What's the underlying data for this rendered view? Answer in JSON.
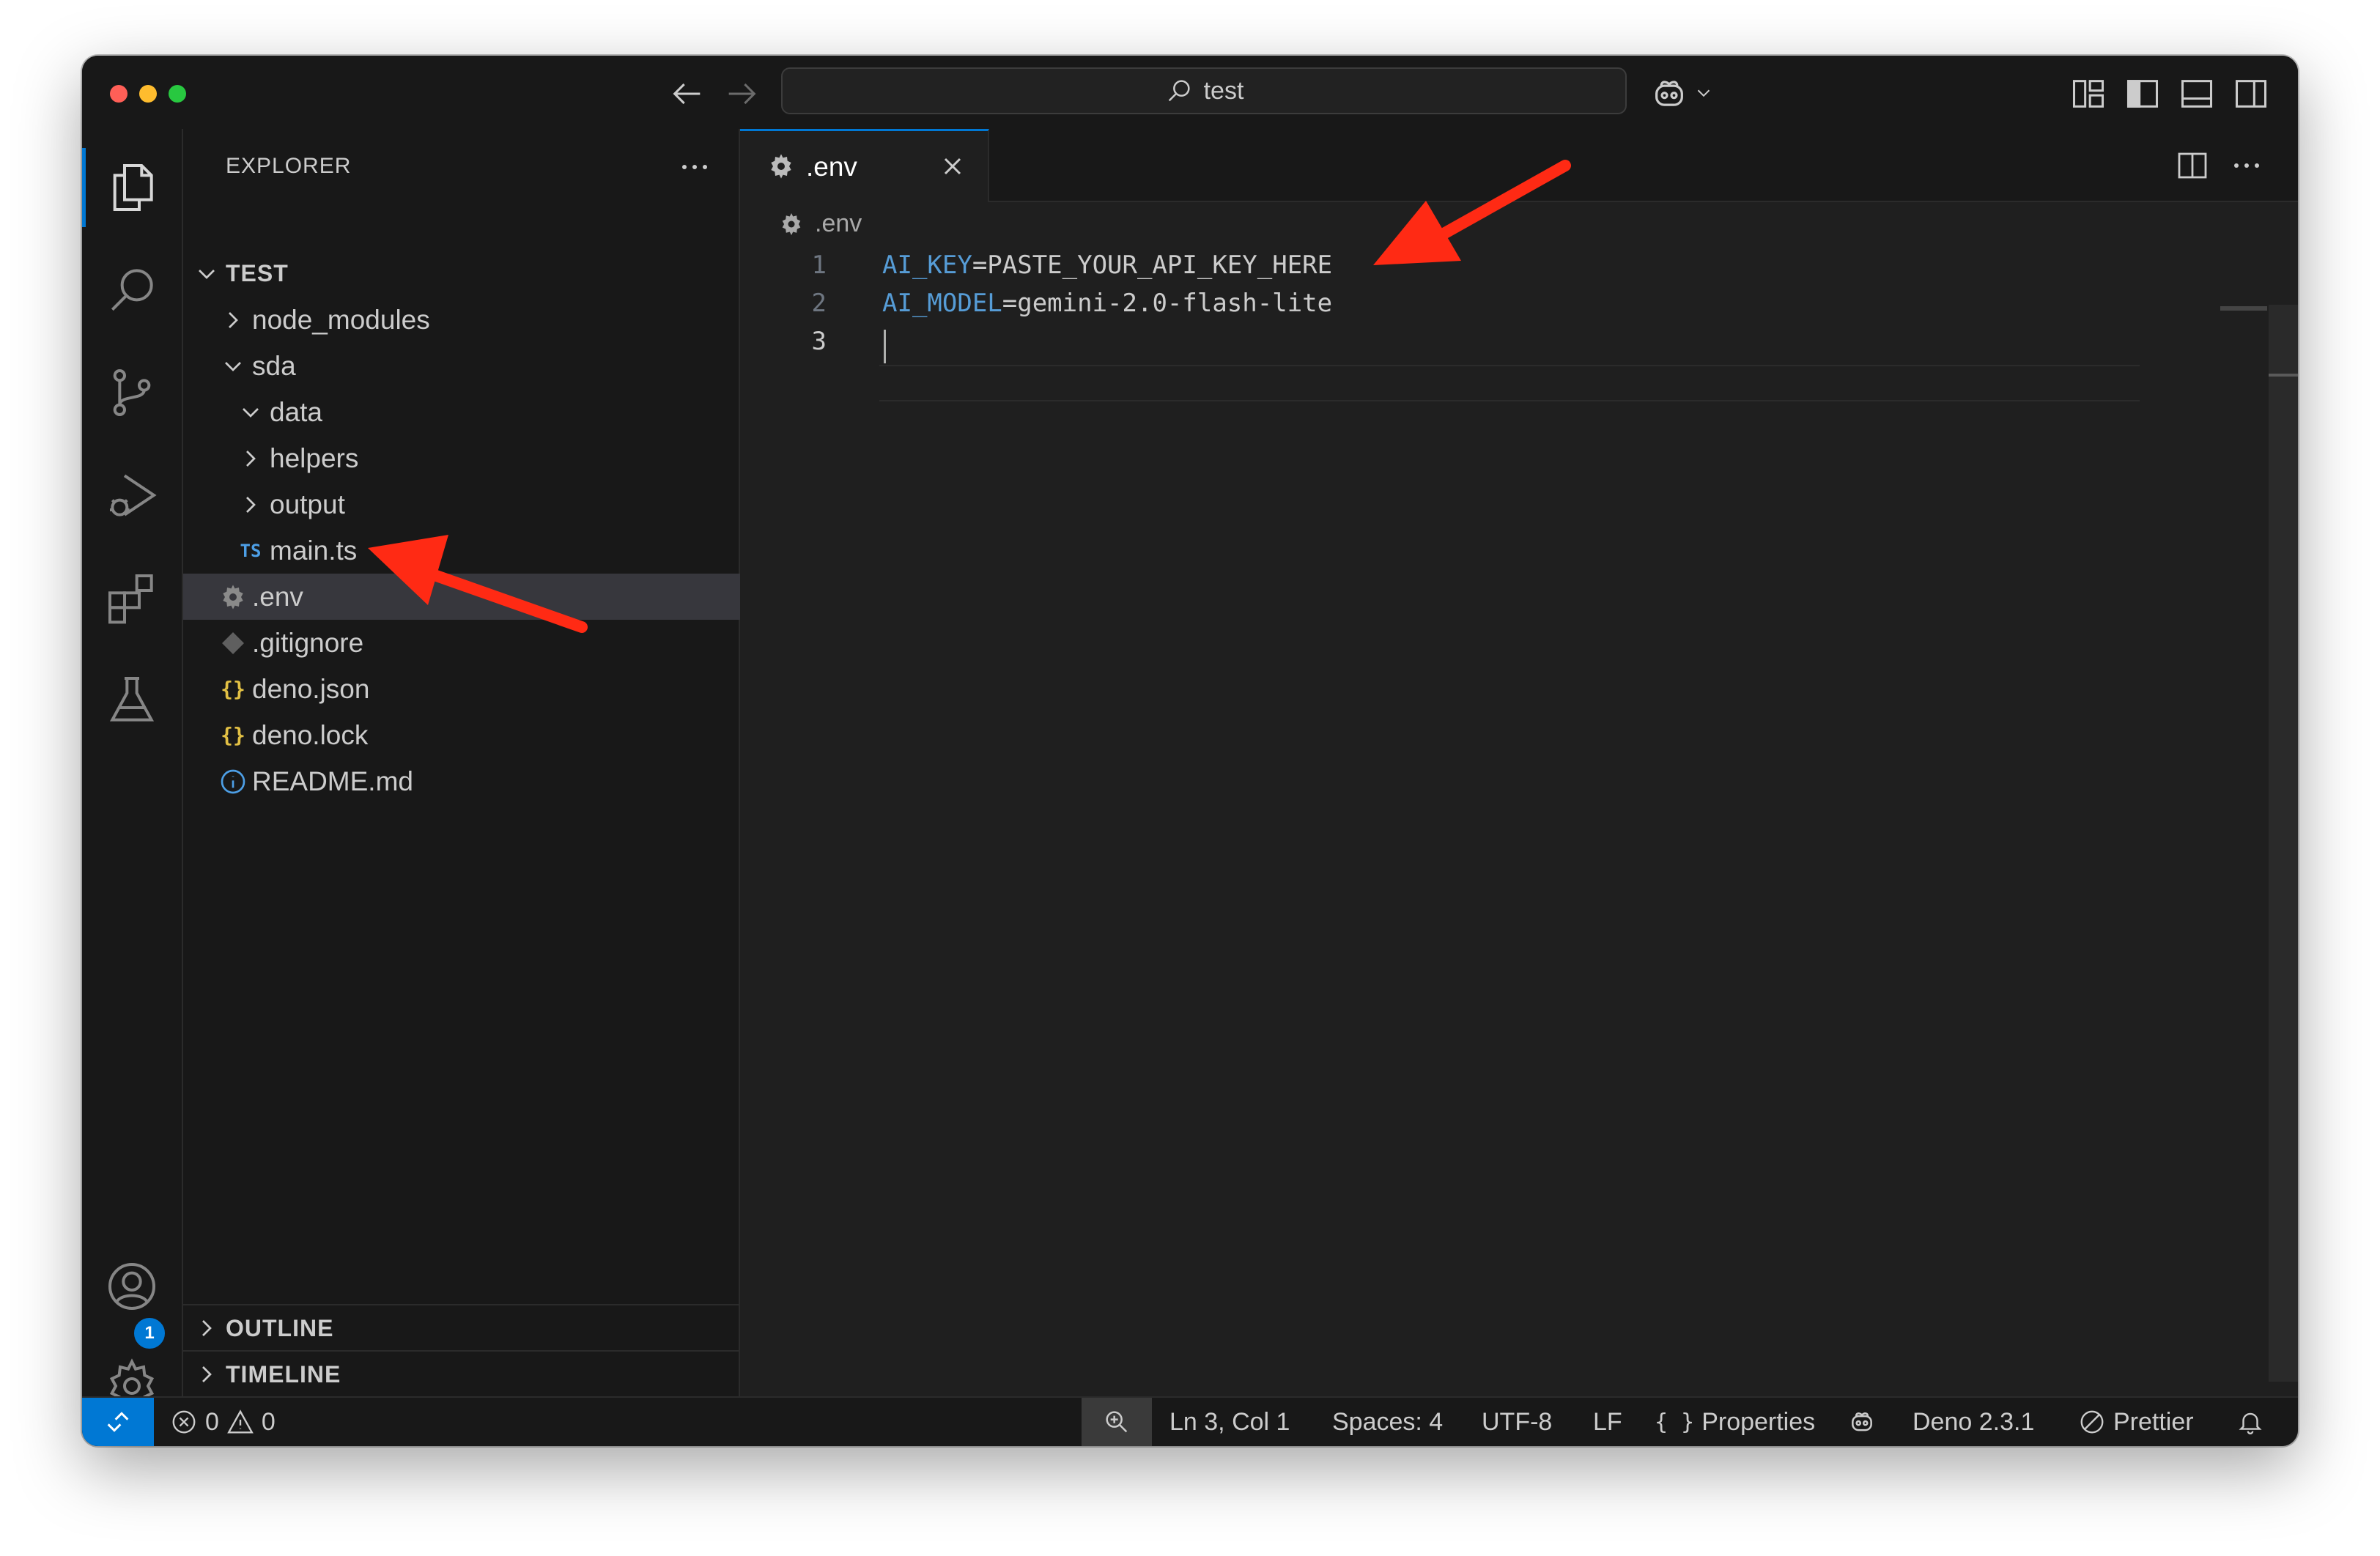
{
  "window": {
    "search_text": "test"
  },
  "explorer": {
    "title": "EXPLORER",
    "root": "TEST",
    "items": [
      {
        "label": "node_modules"
      },
      {
        "label": "sda"
      },
      {
        "label": "data"
      },
      {
        "label": "helpers"
      },
      {
        "label": "output"
      },
      {
        "label": "main.ts",
        "badge": "TS"
      },
      {
        "label": ".env"
      },
      {
        "label": ".gitignore"
      },
      {
        "label": "deno.json",
        "badge": "{}"
      },
      {
        "label": "deno.lock",
        "badge": "{}"
      },
      {
        "label": "README.md"
      }
    ],
    "outline": "OUTLINE",
    "timeline": "TIMELINE"
  },
  "editor": {
    "tab_label": ".env",
    "breadcrumb": ".env",
    "lines": [
      {
        "num": "1",
        "key": "AI_KEY",
        "value": "=PASTE_YOUR_API_KEY_HERE"
      },
      {
        "num": "2",
        "key": "AI_MODEL",
        "value": "=gemini-2.0-flash-lite"
      },
      {
        "num": "3",
        "key": "",
        "value": ""
      }
    ]
  },
  "activity": {
    "accounts_badge": "1"
  },
  "status": {
    "errors": "0",
    "warnings": "0",
    "position": "Ln 3, Col 1",
    "spaces": "Spaces: 4",
    "encoding": "UTF-8",
    "eol": "LF",
    "language": "Properties",
    "deno": "Deno 2.3.1",
    "prettier": "Prettier"
  },
  "colors": {
    "accent": "#0078d4",
    "annotation_arrow": "#ff2a14",
    "key_token": "#569cd6"
  }
}
